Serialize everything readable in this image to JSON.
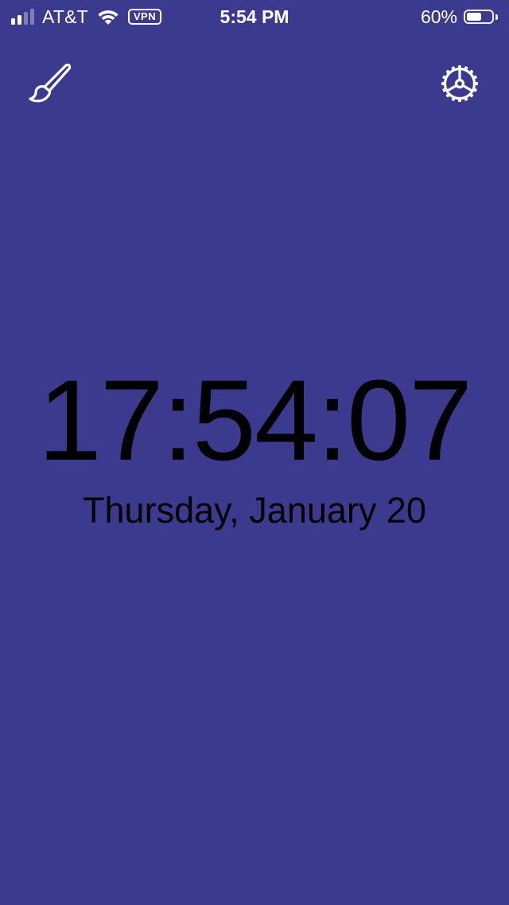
{
  "status_bar": {
    "carrier": "AT&T",
    "vpn": "VPN",
    "time": "5:54 PM",
    "battery_percent": "60%",
    "battery_level": 0.6,
    "signal_bars_active": 2,
    "signal_bars_total": 4,
    "icons": [
      "signal-icon",
      "wifi-icon",
      "battery-icon"
    ]
  },
  "toolbar": {
    "left_icon": "paintbrush-icon",
    "right_icon": "gear-icon"
  },
  "clock": {
    "time": "17:54:07",
    "date": "Thursday, January 20"
  },
  "colors": {
    "background": "#3b3a8e",
    "clock_text": "#000000",
    "icons": "#ffffff"
  }
}
